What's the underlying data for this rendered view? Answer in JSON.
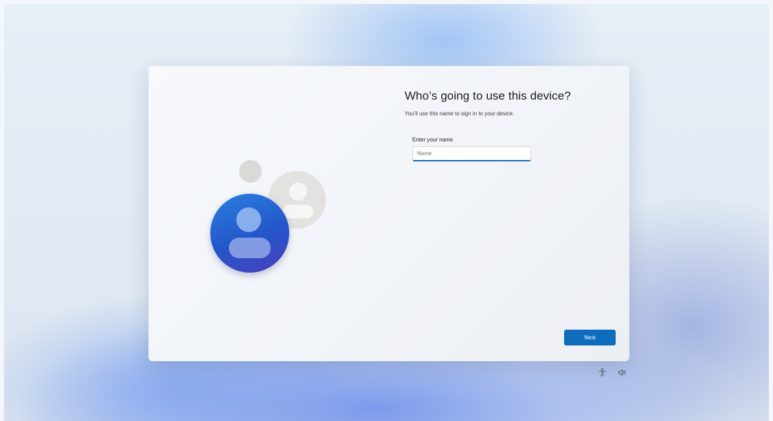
{
  "setup": {
    "title": "Who’s going to use this device?",
    "subtitle": "You’ll use this name to sign in to your device.",
    "name_label": "Enter your name",
    "name_placeholder": "Name",
    "name_value": "",
    "next_label": "Next"
  },
  "tray": {
    "accessibility_icon": "accessibility-icon",
    "volume_icon": "volume-icon"
  },
  "colors": {
    "accent": "#0f6cbd",
    "input_underline": "#2166b0",
    "avatar_blue": "#2456c9"
  }
}
